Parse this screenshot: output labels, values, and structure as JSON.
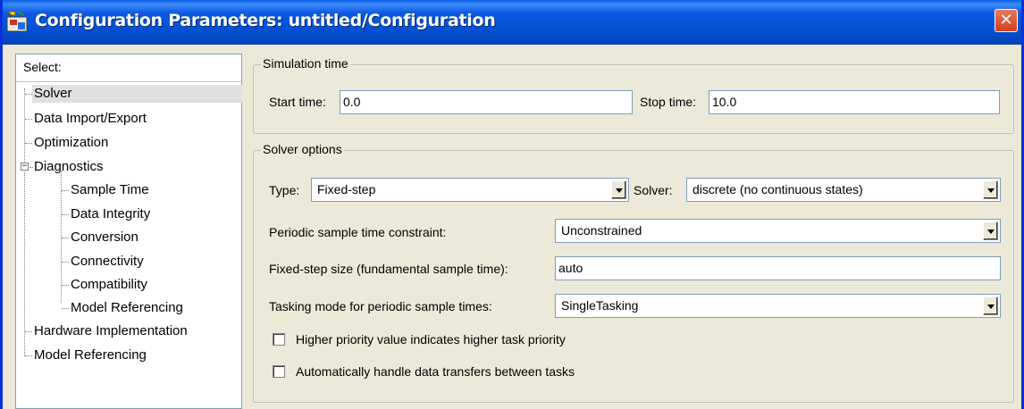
{
  "window": {
    "title": "Configuration Parameters: untitled/Configuration",
    "close_glyph": "✕"
  },
  "tree": {
    "header": "Select:",
    "expander_glyph": "−",
    "items": [
      {
        "label": "Solver"
      },
      {
        "label": "Data Import/Export"
      },
      {
        "label": "Optimization"
      },
      {
        "label": "Diagnostics"
      },
      {
        "label": "Sample Time"
      },
      {
        "label": "Data Integrity"
      },
      {
        "label": "Conversion"
      },
      {
        "label": "Connectivity"
      },
      {
        "label": "Compatibility"
      },
      {
        "label": "Model Referencing"
      },
      {
        "label": "Hardware Implementation"
      },
      {
        "label": "Model Referencing"
      }
    ]
  },
  "simulation_time": {
    "title": "Simulation time",
    "start_label": "Start time:",
    "start_value": "0.0",
    "stop_label": "Stop time:",
    "stop_value": "10.0"
  },
  "solver_options": {
    "title": "Solver options",
    "type_label": "Type:",
    "type_value": "Fixed-step",
    "solver_label": "Solver:",
    "solver_value": "discrete (no continuous states)",
    "periodic_label": "Periodic sample time constraint:",
    "periodic_value": "Unconstrained",
    "stepsize_label": "Fixed-step size (fundamental sample time):",
    "stepsize_value": "auto",
    "tasking_label": "Tasking mode for periodic sample times:",
    "tasking_value": "SingleTasking",
    "priority_label": "Higher priority value indicates higher task priority",
    "transfers_label": "Automatically handle data transfers between tasks"
  },
  "colors": {
    "titlebar": "#0553d6",
    "selection": "#e0e0e0"
  }
}
